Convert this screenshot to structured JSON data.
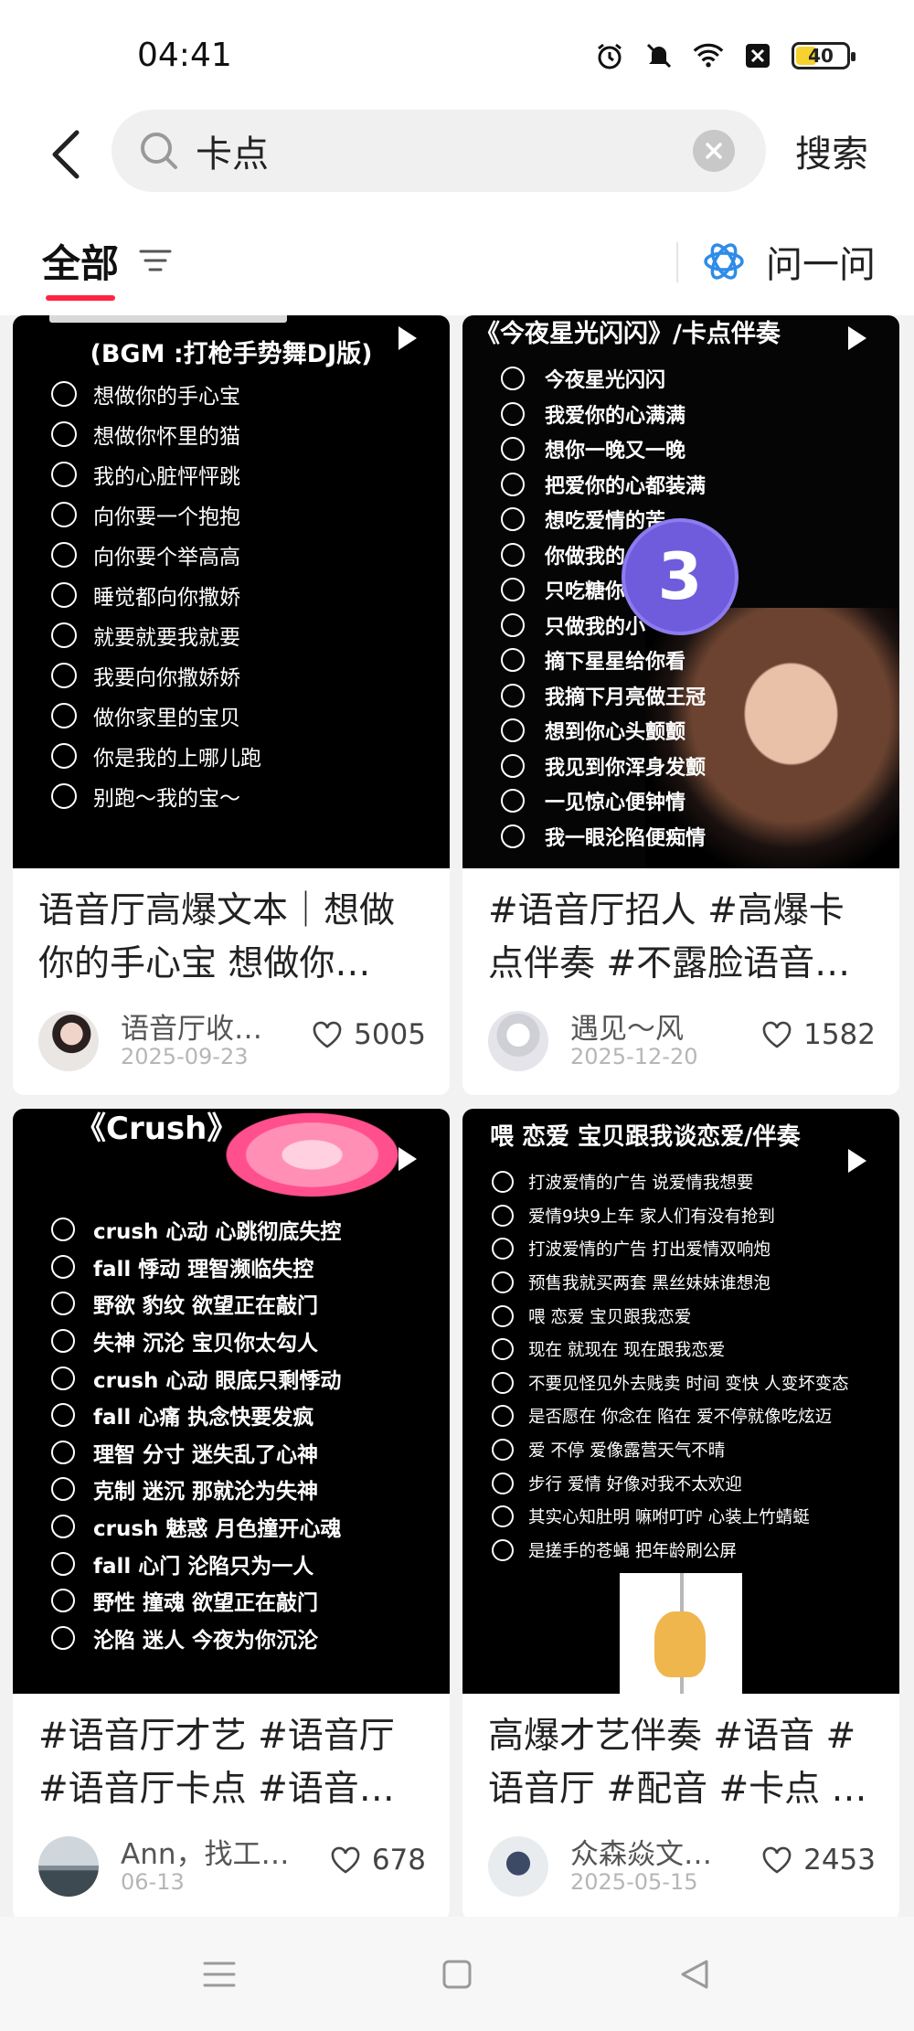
{
  "status_bar": {
    "time": "04:41",
    "battery": "40",
    "battery_level": 0.4
  },
  "search": {
    "query": "卡点",
    "submit_label": "搜索"
  },
  "filter": {
    "active_tab": "全部",
    "ask_label": "问一问"
  },
  "colors": {
    "accent": "#ff2442",
    "ask_icon": "#2f8ce8"
  },
  "cards": [
    {
      "cover_heading": "(BGM :打枪手势舞DJ版)",
      "lyrics": [
        "想做你的手心宝",
        "想做你怀里的猫",
        "我的心脏怦怦跳",
        "向你要一个抱抱",
        "向你要个举高高",
        "睡觉都向你撒娇",
        "就要就要我就要",
        "我要向你撒娇娇",
        "做你家里的宝贝",
        "你是我的上哪儿跑",
        "别跑～我的宝～"
      ],
      "title": "语音厅高爆文本｜想做你的手心宝 想做你…",
      "author": "语音厅收…",
      "date": "2025-09-23",
      "likes": "5005"
    },
    {
      "cover_heading": "《今夜星光闪闪》/卡点伴奏",
      "lyrics": [
        "今夜星光闪闪",
        "我爱你的心满满",
        "想你一晚又一晚",
        "把爱你的心都装满",
        "想吃爱情的苦",
        "你做我的",
        "只吃糖你",
        "只做我的小",
        "摘下星星给你看",
        "我摘下月亮做王冠",
        "想到你心头颤颤",
        "我见到你浑身发颤",
        "一见惊心便钟情",
        "我一眼沦陷便痴情"
      ],
      "badge": "3",
      "title": "#语音厅招人 #高爆卡点伴奏 #不露脸语音…",
      "author": "遇见～风",
      "date": "2025-12-20",
      "likes": "1582"
    },
    {
      "cover_heading": "《Crush》",
      "lyrics": [
        "crush  心动   心跳彻底失控",
        "fall   悸动   理智濒临失控",
        "野欲   豹纹   欲望正在敲门",
        "失神   沉沦   宝贝你太勾人",
        "crush  心动   眼底只剩悸动",
        "fall   心痛   执念快要发疯",
        "理智   分寸  迷失乱了心神",
        "克制   迷沉 那就沦为失神",
        "crush  魅惑   月色撞开心魂",
        "fall   心门   沦陷只为一人",
        "野性   撞魂  欲望正在敲门",
        "沦陷   迷人  今夜为你沉沦"
      ],
      "title": "#语音厅才艺 #语音厅 #语音厅卡点 #语音厅…",
      "author": "Ann，找工…",
      "date": "06-13",
      "likes": "678"
    },
    {
      "cover_heading": "喂 恋爱 宝贝跟我谈恋爱/伴奏",
      "lyrics": [
        "打波爱情的广告 说爱情我想要",
        "爱情9块9上车 家人们有没有抢到",
        "打波爱情的广告 打出爱情双响炮",
        "预售我就买两套 黑丝妹妹谁想泡",
        "喂 恋爱 宝贝跟我恋爱",
        "现在 就现在 现在跟我恋爱",
        "不要见怪见外去贱卖 时间 变快 人变坏变态",
        "是否愿在 你念在 陷在 爱不停就像吃炫迈",
        "爱 不停 爱像露营天气不晴",
        "步行 爱情 好像对我不太欢迎",
        "其实心知肚明 嘛咐叮咛 心装上竹蜻蜓",
        "是搓手的苍蝇 把年龄刷公屏"
      ],
      "title": "高爆才艺伴奏 #语音 #语音厅 #配音 #卡点 …",
      "author": "众森焱文…",
      "date": "2025-05-15",
      "likes": "2453"
    }
  ]
}
